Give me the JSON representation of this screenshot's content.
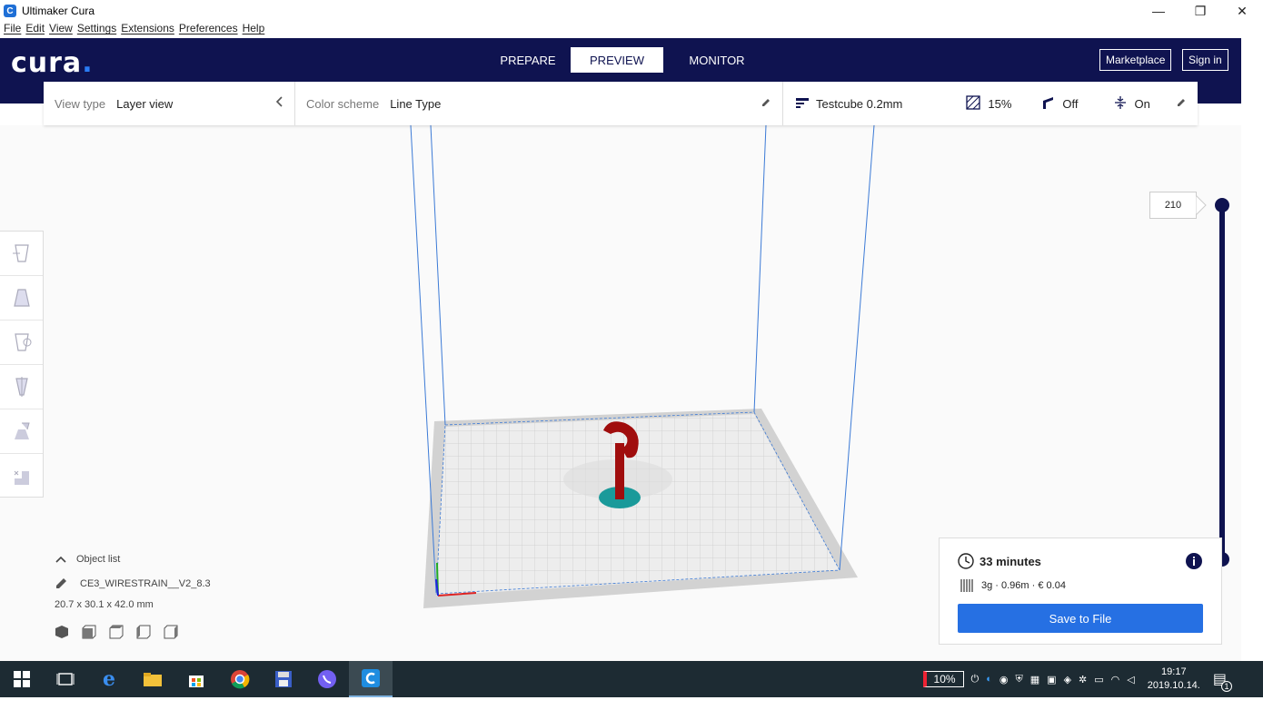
{
  "window": {
    "title": "Ultimaker Cura",
    "app_icon": "C",
    "minimize": "—",
    "restore": "❐",
    "close": "✕"
  },
  "menu": [
    "File",
    "Edit",
    "View",
    "Settings",
    "Extensions",
    "Preferences",
    "Help"
  ],
  "header": {
    "logo_text": "cura",
    "logo_dot": ".",
    "stages": [
      "PREPARE",
      "PREVIEW",
      "MONITOR"
    ],
    "active_stage": "PREVIEW",
    "marketplace": "Marketplace",
    "signin": "Sign in"
  },
  "settings_bar": {
    "view_type_label": "View type",
    "view_type_value": "Layer view",
    "color_scheme_label": "Color scheme",
    "color_scheme_value": "Line Type",
    "profile": "Testcube 0.2mm",
    "infill": "15%",
    "support": "Off",
    "adhesion": "On"
  },
  "layer_slider": {
    "top_value": "210"
  },
  "object_list": {
    "label": "Object list",
    "object_name": "CE3_WIRESTRAIN__V2_8.3",
    "dimensions": "20.7 x 30.1 x 42.0 mm"
  },
  "print_info": {
    "time": "33 minutes",
    "material": "3g · 0.96m · € 0.04",
    "save_button": "Save to File"
  },
  "taskbar": {
    "battery": "10%",
    "time": "19:17",
    "date": "2019.10.14.",
    "notification_count": "1"
  },
  "colors": {
    "header_bg": "#0f1350",
    "accent": "#2670e3",
    "model_red": "#a00d0d",
    "model_base": "#1a9a9a"
  }
}
